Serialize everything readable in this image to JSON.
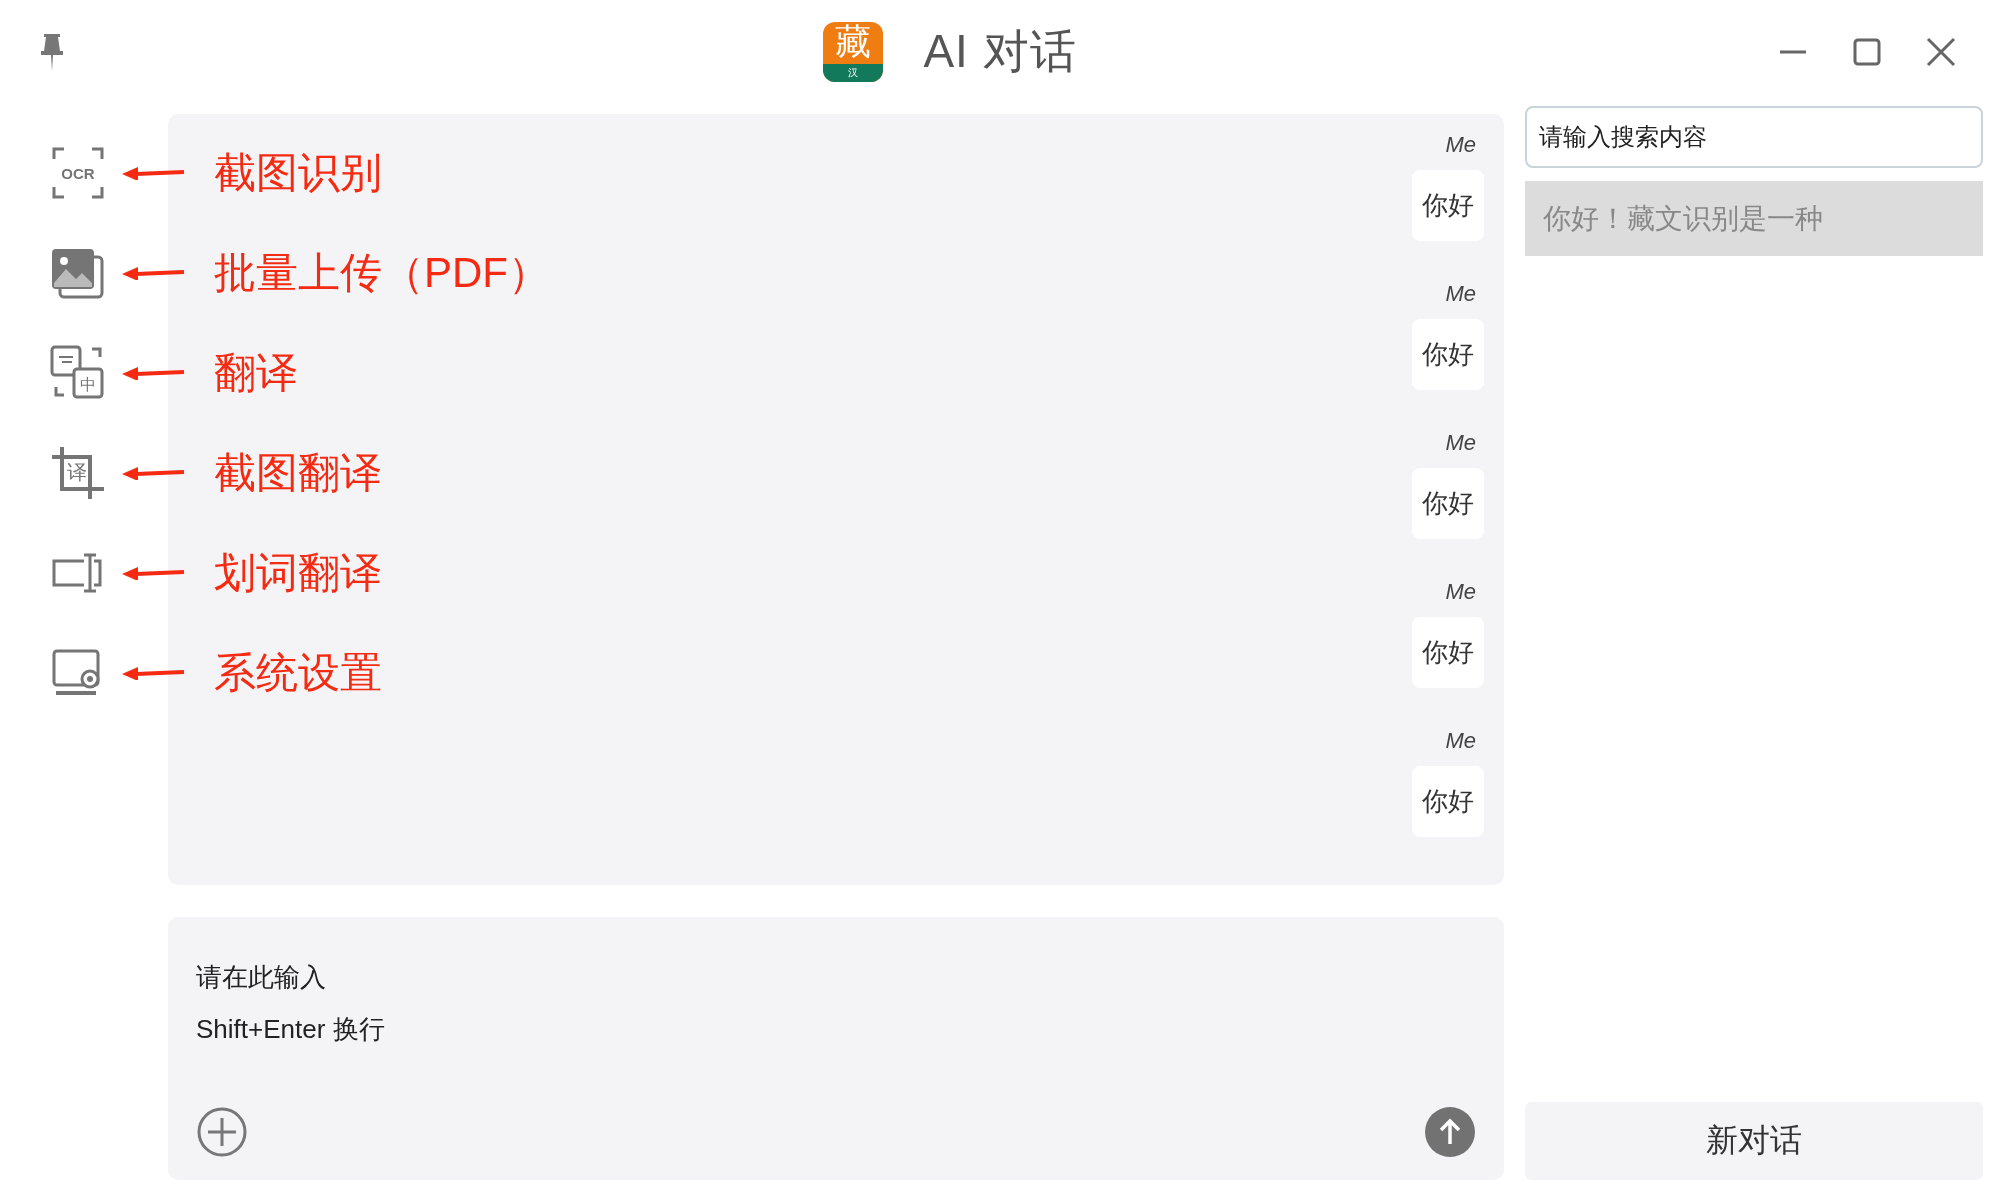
{
  "window": {
    "title": "AI 对话",
    "logo": {
      "glyph": "藏",
      "subtitle": "汉"
    }
  },
  "sidebar": {
    "items": [
      {
        "kind": "ocr",
        "icon_label": "OCR",
        "annotation": "截图识别"
      },
      {
        "kind": "images",
        "annotation": "批量上传（PDF）"
      },
      {
        "kind": "translate",
        "icon_label": "中",
        "annotation": "翻译"
      },
      {
        "kind": "crop",
        "icon_label": "译",
        "annotation": "截图翻译"
      },
      {
        "kind": "select",
        "annotation": "划词翻译"
      },
      {
        "kind": "settings",
        "annotation": "系统设置"
      }
    ]
  },
  "chat": {
    "messages": [
      {
        "sender": "Me",
        "text": "你好"
      },
      {
        "sender": "Me",
        "text": "你好"
      },
      {
        "sender": "Me",
        "text": "你好"
      },
      {
        "sender": "Me",
        "text": "你好"
      },
      {
        "sender": "Me",
        "text": "你好"
      }
    ]
  },
  "composer": {
    "placeholder": "请在此输入\nShift+Enter 换行"
  },
  "history": {
    "search": {
      "placeholder": "请输入搜索内容"
    },
    "items": [
      {
        "title": "你好！藏文识别是一种",
        "selected": true
      }
    ],
    "new_button": "新对话"
  }
}
